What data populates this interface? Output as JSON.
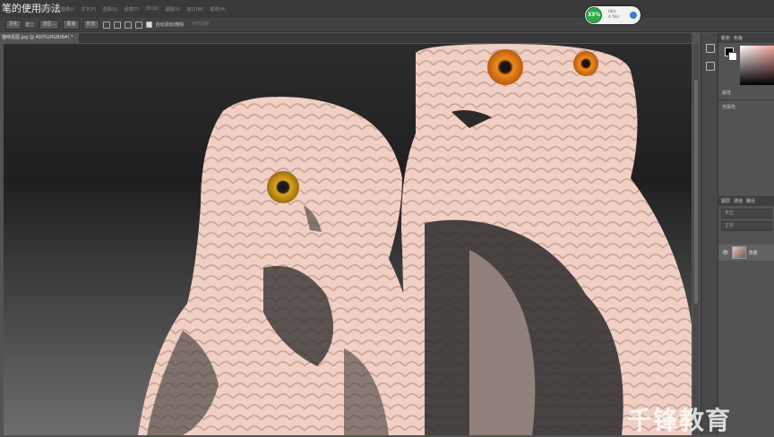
{
  "lesson_title": "笔的使用方法",
  "menu": [
    "编辑(E)",
    "图像(I)",
    "文字(Y)",
    "选择(S)",
    "滤镜(T)",
    "3D(D)",
    "视图(V)",
    "窗口(W)",
    "帮助(H)"
  ],
  "options": {
    "feather_value": "羽化",
    "create_label": "建立:",
    "selection_dropdown": "选区...",
    "mask_button": "蒙版",
    "shape_button": "形状",
    "auto_add_delete": "自动添加/删除",
    "align_edges": "对齐边缘"
  },
  "document_tab": "猫咪抠图.jpg @ 400%(RGB/8#) *",
  "panels": {
    "color_tab": "颜色",
    "swatches_tab": "色板",
    "properties_title": "属性",
    "properties_value": "无属性",
    "layers_tab": "图层",
    "channels_tab": "通道",
    "paths_tab": "路径",
    "layer_filter": "类型",
    "blend_mode": "正常",
    "layer_name": "背景"
  },
  "performance": {
    "percent": "33%",
    "upload": "0K/s",
    "download": "4.7K/s"
  },
  "colors": {
    "foreground": "#000000",
    "background": "#ffffff",
    "accent": "#2fa845"
  },
  "watermark": "千锋教育"
}
